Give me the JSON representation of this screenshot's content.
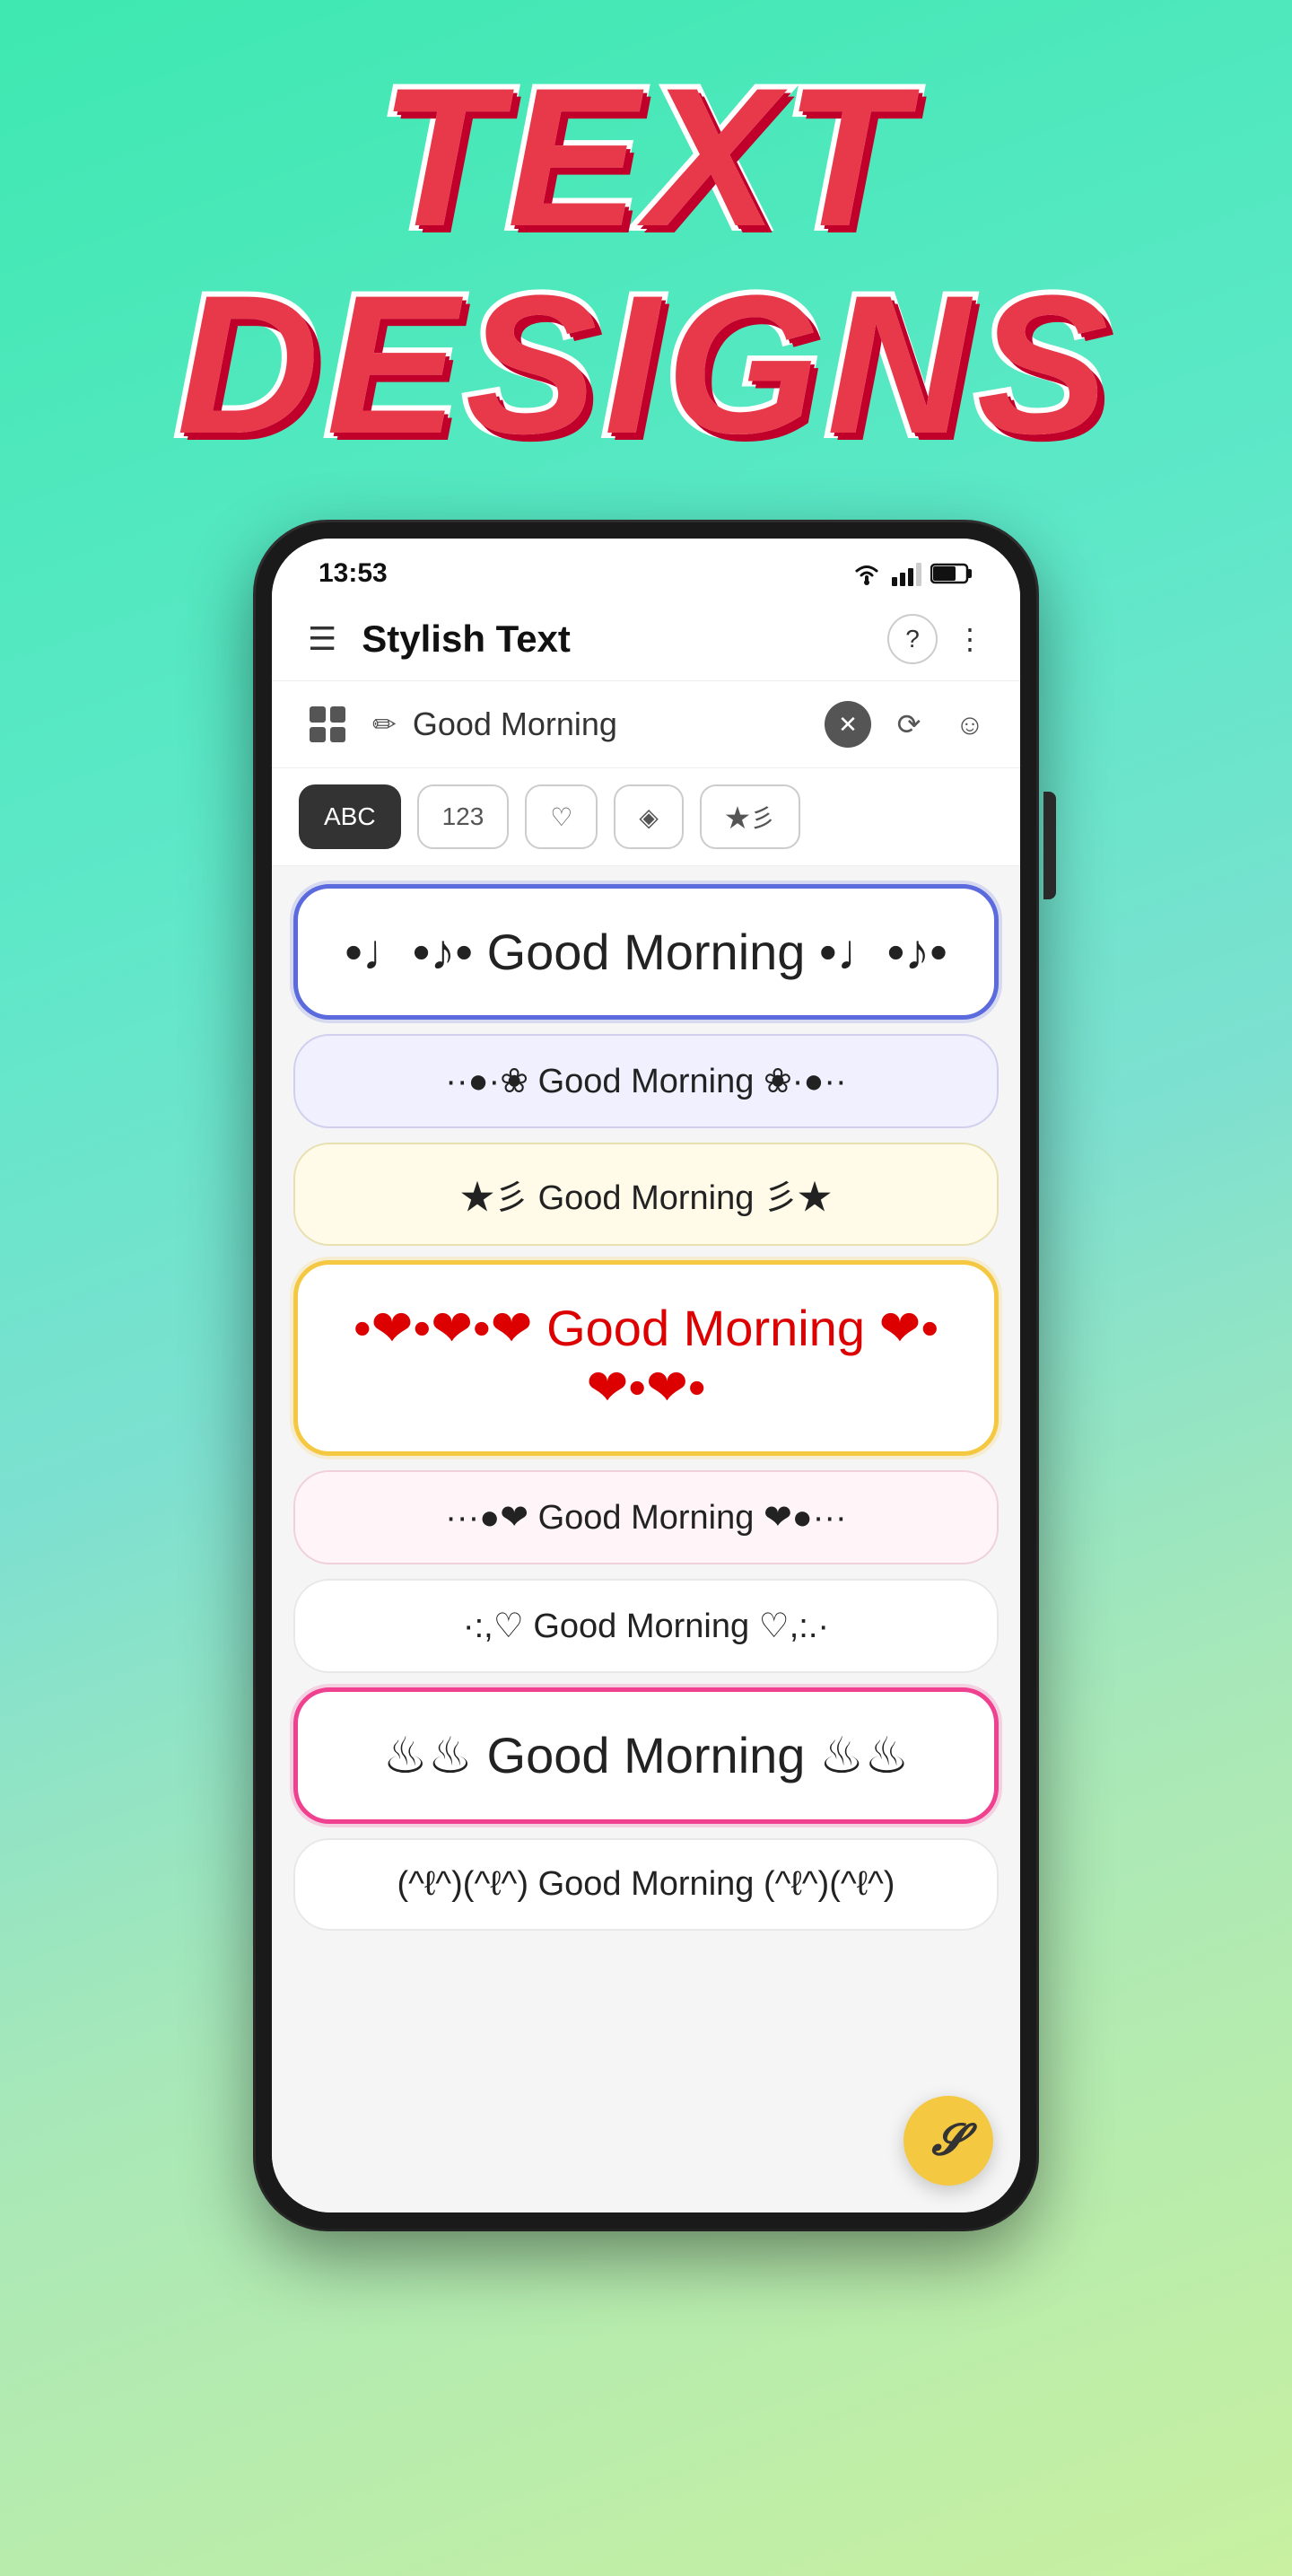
{
  "header": {
    "line1": "TEXT",
    "line2": "DESIGNS"
  },
  "phone": {
    "status": {
      "time": "13:53"
    },
    "app": {
      "title": "Stylish Text"
    },
    "search": {
      "value": "Good Morning",
      "placeholder": "Good Morning"
    },
    "filter_tabs": [
      {
        "label": "ABC",
        "active": true
      },
      {
        "label": "123",
        "active": false
      },
      {
        "label": "♡",
        "active": false
      },
      {
        "label": "◈",
        "active": false
      },
      {
        "label": "★彡",
        "active": false
      }
    ],
    "text_items": [
      {
        "id": "item1",
        "text": "•♩•♪• Good Morning •♩•♪•",
        "style": "selected-blue",
        "size": "large"
      },
      {
        "id": "item2",
        "text": "··●·❀ Good Morning ❀·●··",
        "style": "light-bg",
        "size": "normal"
      },
      {
        "id": "item3",
        "text": "★彡 Good Morning 彡★",
        "style": "yellow-bg",
        "size": "normal"
      },
      {
        "id": "item4",
        "text": "•❤•❤•❤ Good Morning ❤•❤•❤•",
        "style": "selected-yellow",
        "size": "large"
      },
      {
        "id": "item5",
        "text": "···●❤ Good Morning ❤●···",
        "style": "pink-bg",
        "size": "normal"
      },
      {
        "id": "item6",
        "text": "·:,♡ Good Morning ♡,:.·",
        "style": "normal",
        "size": "normal"
      },
      {
        "id": "item7",
        "text": "♨♨ Good Morning ♨♨",
        "style": "selected-pink",
        "size": "large"
      },
      {
        "id": "item8",
        "text": "(^ℓ^)(^ℓ^) Good Morning (^ℓ^)(^ℓ^)",
        "style": "normal",
        "size": "normal"
      }
    ],
    "fab": {
      "label": "𝓢"
    }
  }
}
